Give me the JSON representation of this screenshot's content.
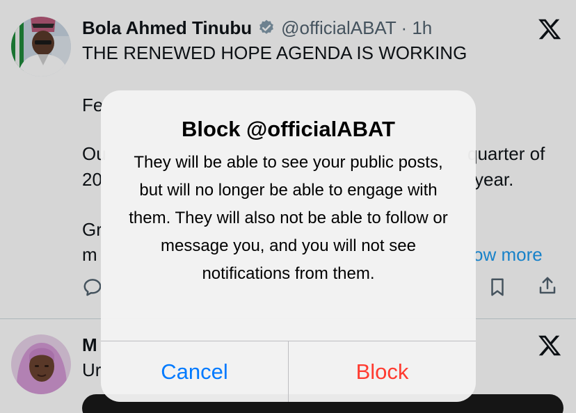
{
  "posts": [
    {
      "author": {
        "display_name": "Bola Ahmed Tinubu",
        "verified_icon": "verified-badge-icon",
        "handle_time": "@officialABAT · 1h"
      },
      "visible_text_lines": [
        "THE RENEWED HOPE AGENDA IS WORKING",
        "Fe",
        "Ou",
        "quarter of",
        "20",
        "year.",
        "Gr",
        "m"
      ],
      "show_more_partial": "ow more",
      "actions": [
        "reply-icon",
        "bookmark-icon",
        "share-icon"
      ]
    },
    {
      "author": {
        "display_name_partial": "M"
      },
      "visible_text_lines": [
        "Ur"
      ]
    }
  ],
  "dialog": {
    "title": "Block @officialABAT",
    "message": "They will be able to see your public posts, but will no longer be able to engage with them. They will also not be able to follow or message you, and you will not see notifications from them.",
    "cancel_label": "Cancel",
    "block_label": "Block"
  },
  "colors": {
    "cancel": "#007aff",
    "block": "#ff3b30",
    "link": "#1d9bf0",
    "verified": "#829aab"
  }
}
